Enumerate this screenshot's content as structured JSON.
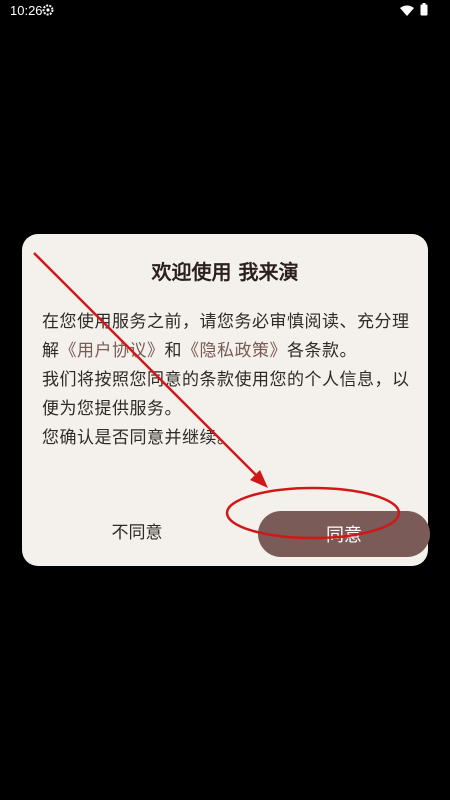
{
  "status_bar": {
    "time": "10:26"
  },
  "dialog": {
    "title": "欢迎使用 我来演",
    "line1": "在您使用服务之前，请您务必审慎阅读、充分理解",
    "link_user_agreement": "《用户协议》",
    "and": "和",
    "link_privacy_policy": "《隐私政策》",
    "line1_end": "各条款。",
    "line2": "我们将按照您同意的条款使用您的个人信息，以便为您提供服务。",
    "line3": "您确认是否同意并继续。",
    "disagree_label": "不同意",
    "agree_label": "同意"
  },
  "colors": {
    "background": "#000000",
    "dialog_bg": "#f4f1ec",
    "accent": "#7b5b57",
    "annotation_red": "#d01818"
  },
  "annotation": {
    "type": "arrow-and-ellipse",
    "target": "agree-button"
  }
}
